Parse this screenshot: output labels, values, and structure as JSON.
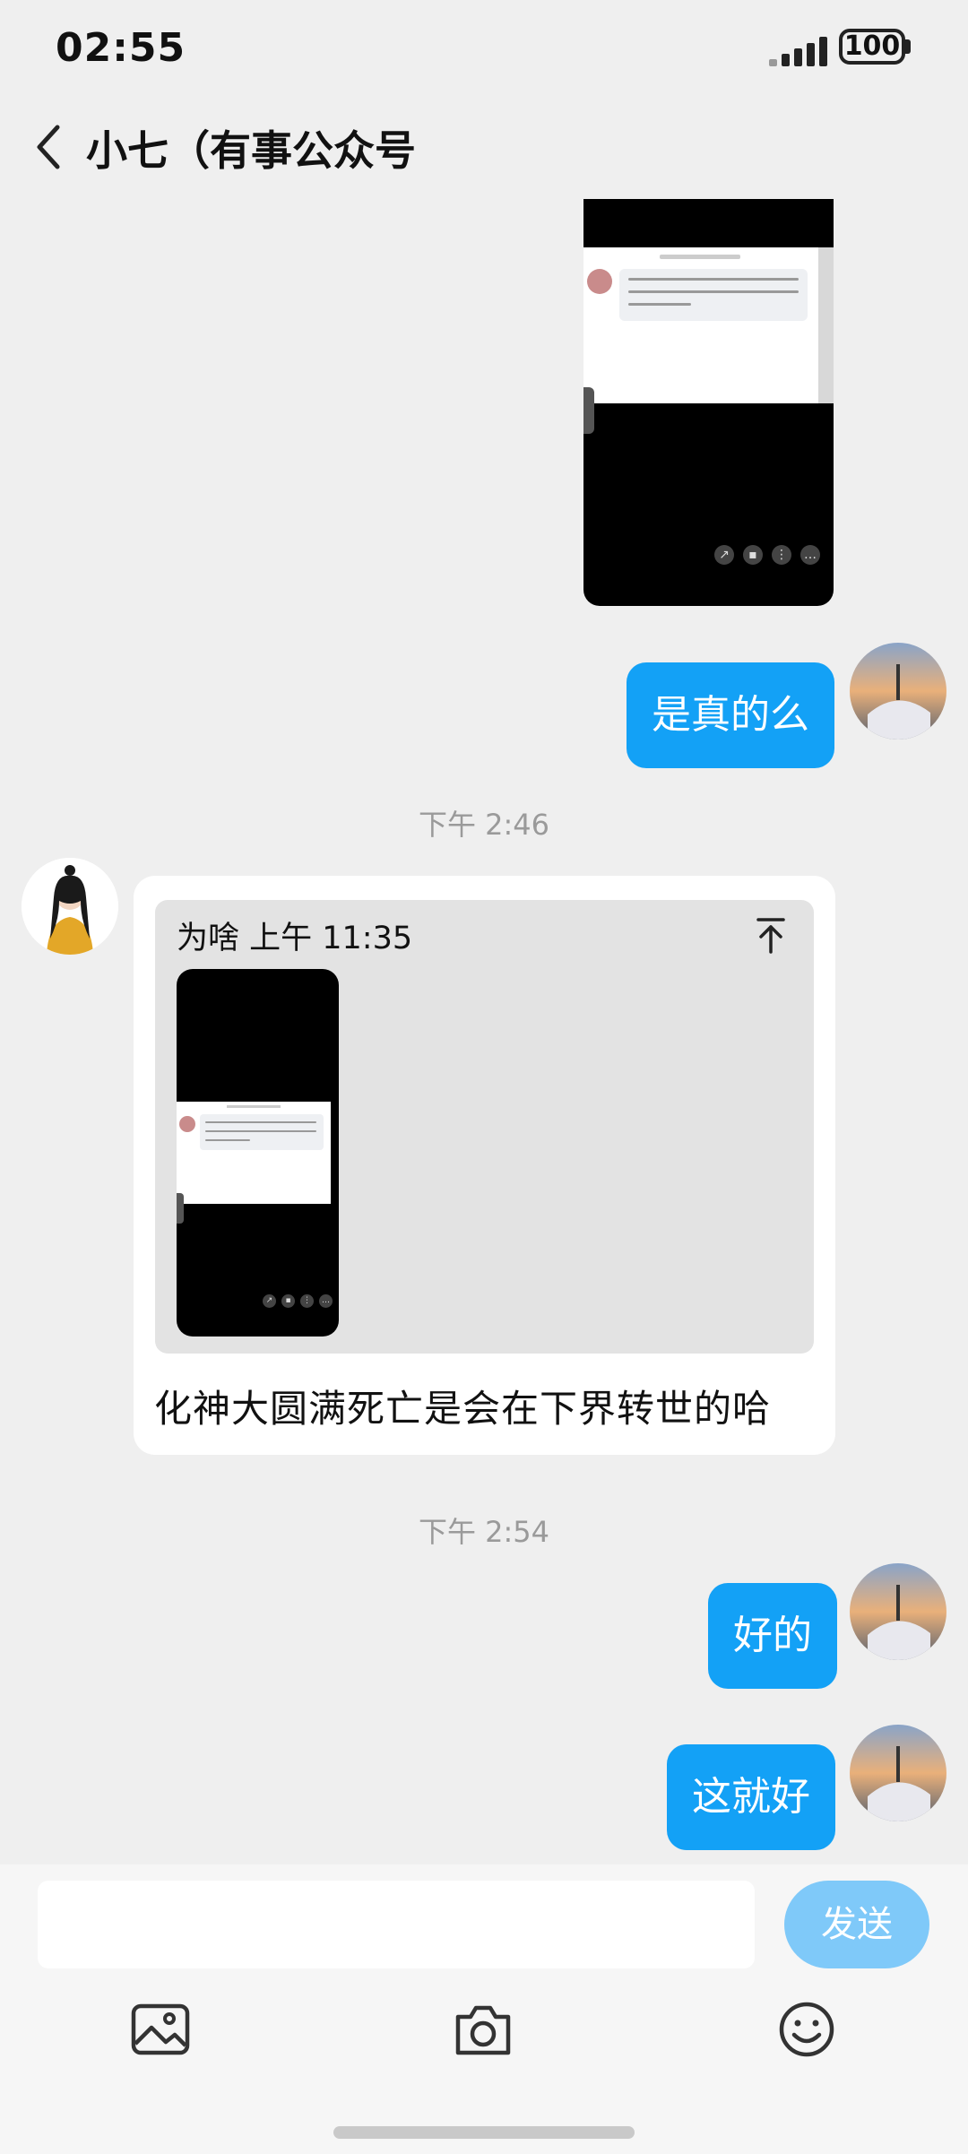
{
  "status_bar": {
    "time": "02:55",
    "battery": "100"
  },
  "header": {
    "title": "小七（有事公众号"
  },
  "messages": {
    "msg1": {
      "text": "是真的么"
    },
    "time1": "下午 2:46",
    "reply_card": {
      "quote_header": "为啥 上午 11:35",
      "text": "化神大圆满死亡是会在下界转世的哈"
    },
    "time2": "下午 2:54",
    "msg2": {
      "text": "好的"
    },
    "msg3": {
      "text": "这就好"
    }
  },
  "input_bar": {
    "placeholder": "",
    "send_label": "发送"
  },
  "icons": {
    "back": "back-arrow-icon",
    "image": "image-icon",
    "camera": "camera-icon",
    "emoji": "emoji-icon",
    "pin": "scroll-to-top-icon"
  },
  "colors": {
    "bubble": "#13a1f6",
    "send": "#7fc9f9",
    "background": "#efefef"
  }
}
